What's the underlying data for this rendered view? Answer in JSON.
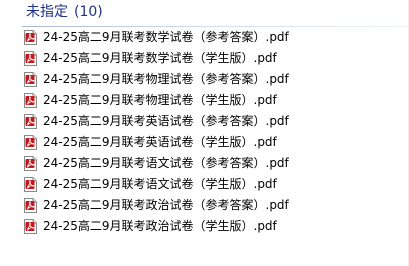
{
  "group": {
    "title": "未指定",
    "count": "(10)"
  },
  "colors": {
    "header_text": "#1e3287",
    "divider": "#a9b8d6",
    "pdf_red": "#c8161d"
  },
  "files": [
    {
      "name": "24-25高二9月联考数学试卷（参考答案）.pdf",
      "icon": "pdf-icon"
    },
    {
      "name": "24-25高二9月联考数学试卷（学生版）.pdf",
      "icon": "pdf-icon"
    },
    {
      "name": "24-25高二9月联考物理试卷（参考答案）.pdf",
      "icon": "pdf-icon"
    },
    {
      "name": "24-25高二9月联考物理试卷（学生版）.pdf",
      "icon": "pdf-icon"
    },
    {
      "name": "24-25高二9月联考英语试卷（参考答案）.pdf",
      "icon": "pdf-icon"
    },
    {
      "name": "24-25高二9月联考英语试卷（学生版）.pdf",
      "icon": "pdf-icon"
    },
    {
      "name": "24-25高二9月联考语文试卷（参考答案）.pdf",
      "icon": "pdf-icon"
    },
    {
      "name": "24-25高二9月联考语文试卷（学生版）.pdf",
      "icon": "pdf-icon"
    },
    {
      "name": "24-25高二9月联考政治试卷（参考答案）.pdf",
      "icon": "pdf-icon"
    },
    {
      "name": "24-25高二9月联考政治试卷（学生版）.pdf",
      "icon": "pdf-icon"
    }
  ]
}
